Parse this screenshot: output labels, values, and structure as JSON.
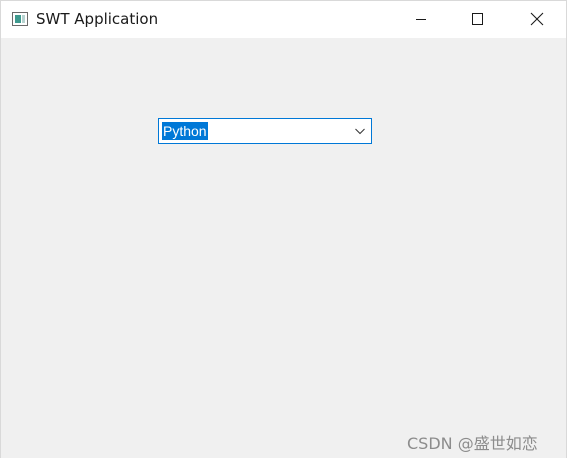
{
  "window": {
    "title": "SWT Application",
    "icon": "app-window-icon"
  },
  "controls": {
    "minimize_icon": "minimize-icon",
    "maximize_icon": "maximize-icon",
    "close_icon": "close-icon"
  },
  "combo": {
    "selected_value": "Python",
    "selected_highlighted": true,
    "icon": "chevron-down-icon"
  },
  "watermark": {
    "text": "CSDN @盛世如恋"
  },
  "colors": {
    "selection": "#0078d7",
    "client_background": "#f0f0f0",
    "titlebar_background": "#ffffff"
  }
}
